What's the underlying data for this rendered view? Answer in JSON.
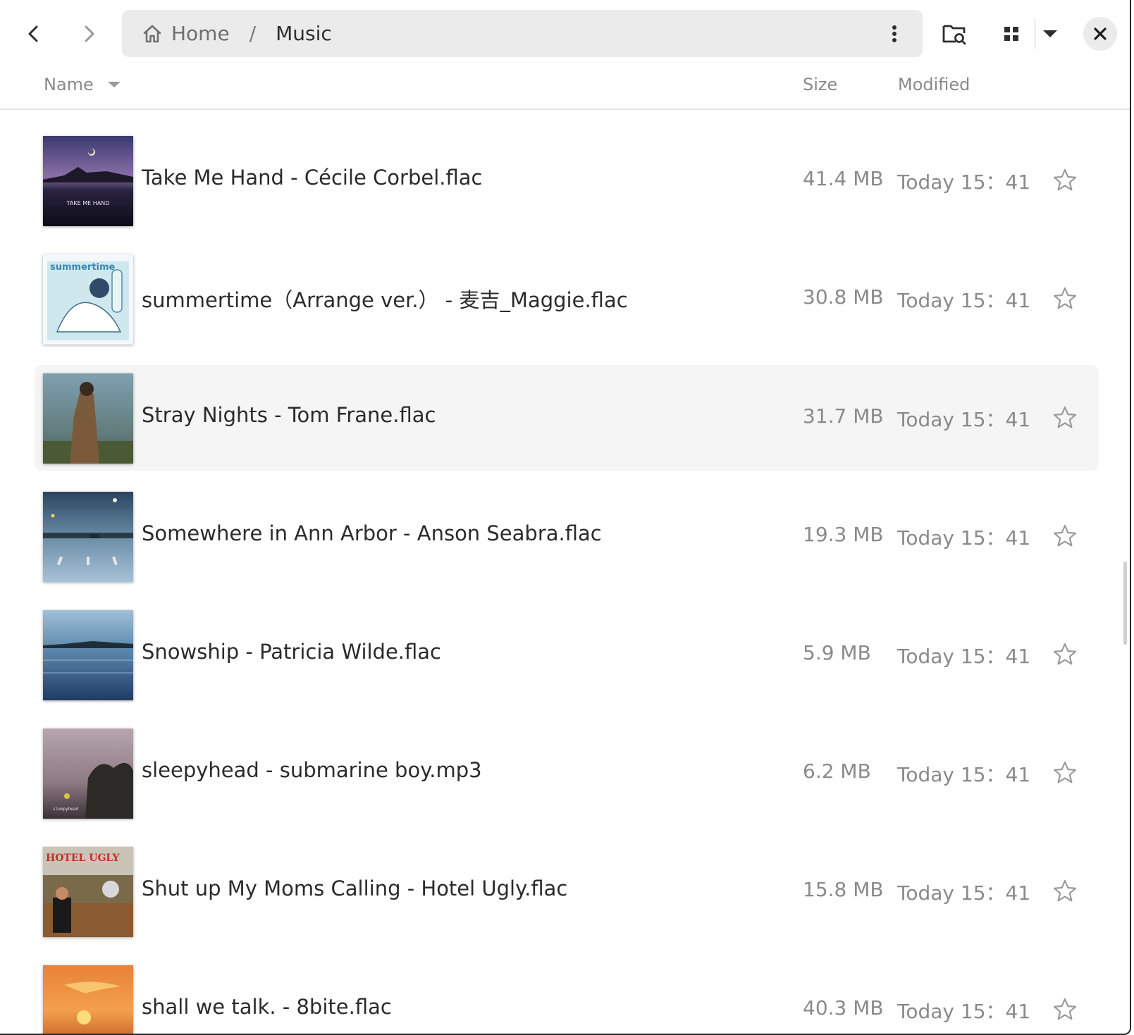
{
  "toolbar": {
    "back_icon": "chevron-left-icon",
    "forward_icon": "chevron-right-icon",
    "breadcrumb": {
      "home_label": "Home",
      "separator": "/",
      "current_label": "Music"
    },
    "path_menu_icon": "kebab-menu-icon",
    "search_icon": "folder-search-icon",
    "grid_icon": "grid-view-icon",
    "dropdown_icon": "caret-down-icon",
    "close_icon": "close-icon"
  },
  "columns": {
    "name": "Name",
    "size": "Size",
    "modified": "Modified"
  },
  "files": [
    {
      "name": "Take Me Hand - Cécile Corbel.flac",
      "size": "41.4 MB",
      "modified": "Today 15：41",
      "starred": false,
      "selected": false,
      "cover_text": "TAKE ME HAND"
    },
    {
      "name": "summertime（Arrange ver.） - 麦吉_Maggie.flac",
      "size": "30.8 MB",
      "modified": "Today 15：41",
      "starred": false,
      "selected": false,
      "cover_text": "summertime"
    },
    {
      "name": "Stray Nights - Tom Frane.flac",
      "size": "31.7 MB",
      "modified": "Today 15：41",
      "starred": false,
      "selected": true
    },
    {
      "name": "Somewhere in Ann Arbor - Anson Seabra.flac",
      "size": "19.3 MB",
      "modified": "Today 15：41",
      "starred": false,
      "selected": false
    },
    {
      "name": "Snowship - Patricia Wilde.flac",
      "size": "5.9 MB",
      "modified": "Today 15：41",
      "starred": false,
      "selected": false
    },
    {
      "name": "sleepyhead - submarine boy.mp3",
      "size": "6.2 MB",
      "modified": "Today 15：41",
      "starred": false,
      "selected": false,
      "cover_text": "sleepyhead"
    },
    {
      "name": "Shut up My Moms Calling - Hotel Ugly.flac",
      "size": "15.8 MB",
      "modified": "Today 15：41",
      "starred": false,
      "selected": false,
      "cover_text": "HOTEL UGLY"
    },
    {
      "name": "shall we talk. - 8bite.flac",
      "size": "40.3 MB",
      "modified": "Today 15：41",
      "starred": false,
      "selected": false
    }
  ],
  "colors": {
    "path_bar_bg": "#ebebeb",
    "selected_row_bg": "#f5f5f5",
    "secondary_text": "#8a8a8a"
  }
}
